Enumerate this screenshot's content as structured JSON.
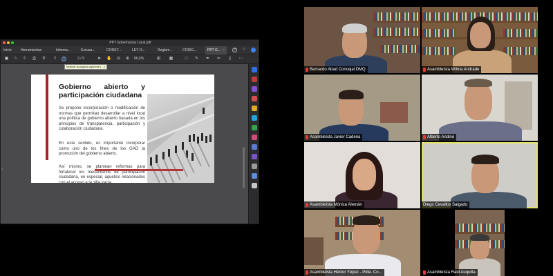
{
  "pdf_window": {
    "title": "PPT Gobernanza Local.pdf",
    "tabs": [
      {
        "label": "Inicio"
      },
      {
        "label": "Herramientas"
      },
      {
        "label": "Informa..."
      },
      {
        "label": "Excusa..."
      },
      {
        "label": "CONST..."
      },
      {
        "label": "LEY O..."
      },
      {
        "label": "Reglam..."
      },
      {
        "label": "CÓDIG..."
      },
      {
        "label": "PPT G..."
      }
    ],
    "tab_close": "×",
    "page_indicator": "2 / 9",
    "zoom_level": "86,6%",
    "tooltip": "Mostrar la página siguiente (→)",
    "toolbar_icons": [
      "save-icon",
      "star-icon",
      "upload-icon",
      "print-icon",
      "search-icon",
      "prev-page-icon",
      "next-page-icon",
      "cursor-icon",
      "hand-icon",
      "zoom-out-icon",
      "zoom-in-icon",
      "fit-icon",
      "comment-icon",
      "pen-icon",
      "sign-icon",
      "share-icon"
    ]
  },
  "slide": {
    "title": "Gobierno abierto y participación ciudadana",
    "paragraphs": [
      "Se propone incorporación o modificación de normas que permitan desarrollar a nivel local una política de gobierno abierto basada en los principios de transparencia, participación y colaboración ciudadana.",
      "En este sentido, es importante incorporar como uno de los fines de los GAD la promoción del gobierno abierto.",
      "Así mismo, se plantean reformas para fortalecer los mecanismos de participación ciudadana, en especial, aquellos relacionados con el acceso a la silla vacía."
    ],
    "accent_color": "#a3252b"
  },
  "participants": [
    {
      "name": "Bernardo Abad Concejal DMQ",
      "muted": true
    },
    {
      "name": "Asambleísta Wilma Andrade",
      "muted": true
    },
    {
      "name": "Asambleísta Javier Cadena",
      "muted": false
    },
    {
      "name": "Alberto Andino",
      "muted": false
    },
    {
      "name": "Asambleísta Mónica Alemán",
      "muted": false
    },
    {
      "name": "Diego Cevallos Salgado",
      "muted": false,
      "active_speaker": true
    },
    {
      "name": "Asambleísta Héctor Yépez - Pdte. Co...",
      "muted": false
    },
    {
      "name": "Asambleísta Raúl Auquilla",
      "muted": true
    }
  ]
}
